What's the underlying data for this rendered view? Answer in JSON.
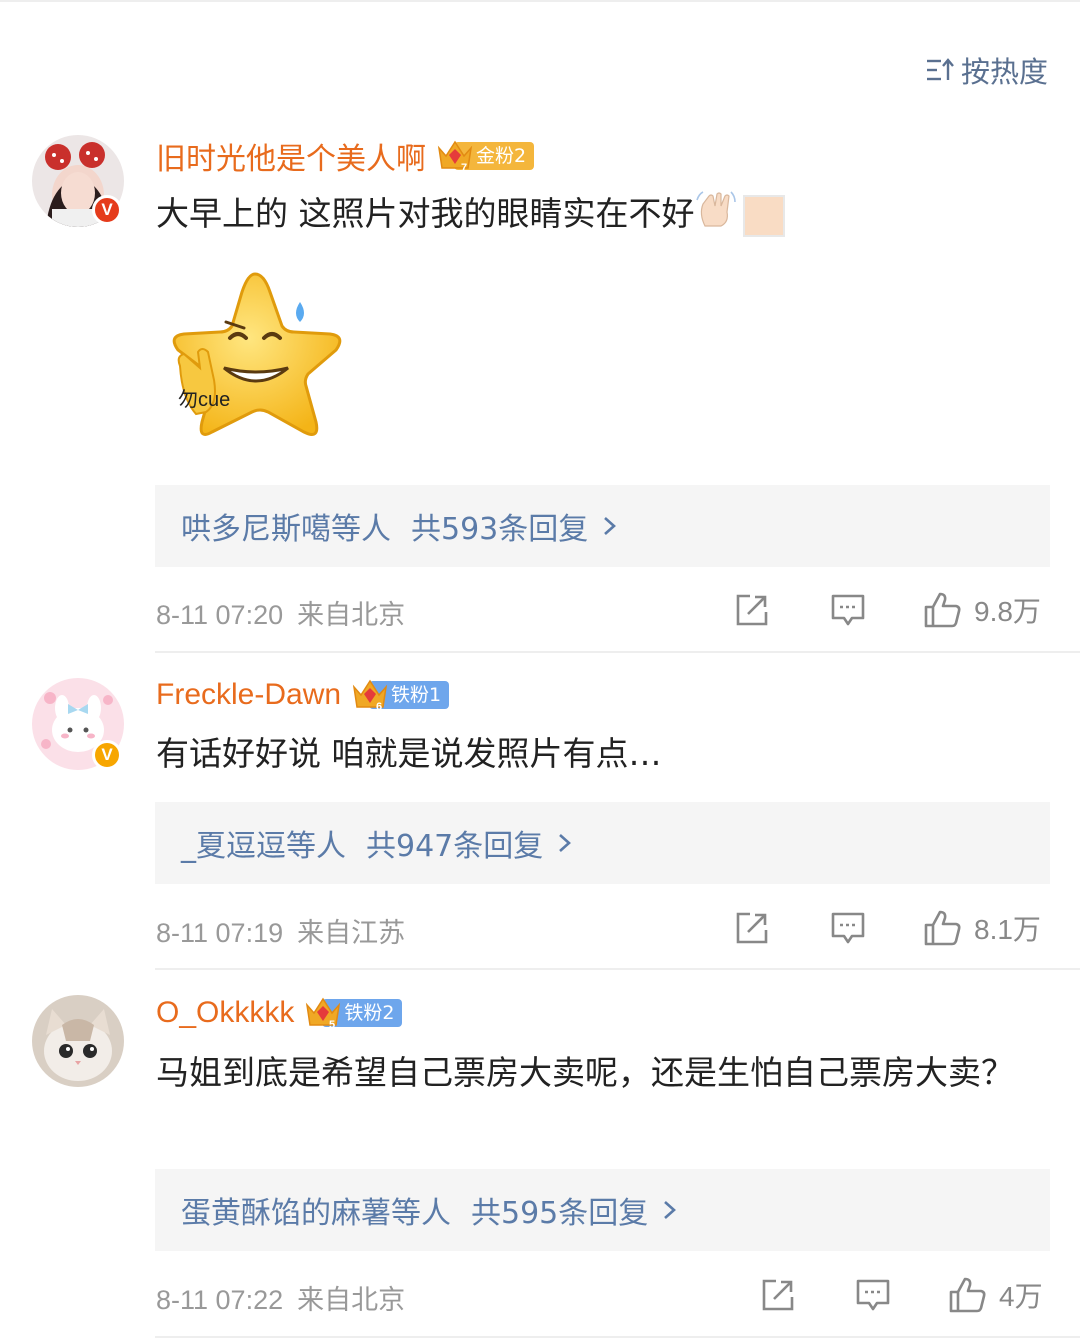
{
  "sort": {
    "label": "按热度",
    "icon": "sort-icon"
  },
  "comments": [
    {
      "username": "旧时光他是个美人啊",
      "fan_level": "金粉2",
      "crown_level": "7",
      "verified": "V",
      "text": "大早上的 这照片对我的眼睛实在不好",
      "sticker_text": "勿cue",
      "replies_who": "哄多尼斯噶等人",
      "replies_count": "共593条回复",
      "date": "8-11 07:20",
      "location": "来自北京",
      "likes": "9.8万"
    },
    {
      "username": "Freckle-Dawn",
      "fan_level": "铁粉1",
      "crown_level": "6",
      "verified": "V",
      "text": "有话好好说 咱就是说发照片有点…",
      "replies_who": "_夏逗逗等人",
      "replies_count": "共947条回复",
      "date": "8-11 07:19",
      "location": "来自江苏",
      "likes": "8.1万"
    },
    {
      "username": "O_Okkkkk",
      "fan_level": "铁粉2",
      "crown_level": "5",
      "text": "马姐到底是希望自己票房大卖呢，还是生怕自己票房大卖？",
      "replies_who": "蛋黄酥馅的麻薯等人",
      "replies_count": "共595条回复",
      "date": "8-11 07:22",
      "location": "来自北京",
      "likes": "4万"
    }
  ],
  "colors": {
    "username": "#e86b1d",
    "link": "#5b7ba8",
    "meta": "#999999",
    "gold_badge": "#f4b63c",
    "iron_badge": "#6ea6ec"
  }
}
